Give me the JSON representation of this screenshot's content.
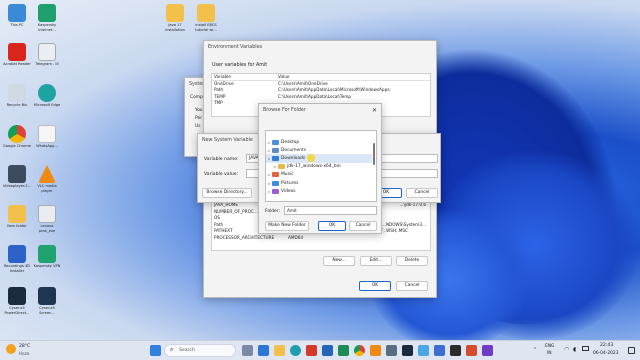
{
  "desktop": {
    "icons": [
      {
        "label": "This PC"
      },
      {
        "label": "Kaspersky Internet..."
      },
      {
        "label": "Acrobat Reader"
      },
      {
        "label": "Telegram - III"
      },
      {
        "label": "Recycle Bin"
      },
      {
        "label": "Microsoft Edge"
      },
      {
        "label": "Google Chrome"
      },
      {
        "label": "WhatsApp..."
      },
      {
        "label": "Videoplayer-2..."
      },
      {
        "label": "VLC media player"
      },
      {
        "label": "New folder"
      },
      {
        "label": "Lenovo pcsk_exe"
      },
      {
        "label": "Recordings 3D Installer"
      },
      {
        "label": "Kaspersky VPN"
      },
      {
        "label": "Cyser.a5 PowerDirect..."
      },
      {
        "label": "Cyser.a5 Screen..."
      },
      {
        "label": "Java 17 installation"
      },
      {
        "label": "install EBCS tutorial wi..."
      }
    ]
  },
  "env_window": {
    "title": "Environment Variables",
    "user_section_label": "User variables for Amit",
    "user_headers": [
      "Variable",
      "Value"
    ],
    "user_rows": [
      [
        "OneDrive",
        "C:\\Users\\Amit\\OneDrive"
      ],
      [
        "Path",
        "C:\\Users\\Amit\\AppData\\Local\\Microsoft\\WindowsApps;"
      ],
      [
        "TEMP",
        "C:\\Users\\Amit\\AppData\\Local\\Temp"
      ],
      [
        "TMP",
        ""
      ]
    ],
    "system_rows": [
      [
        "JAVA_HOME",
        "...\\jdk-17.0.6"
      ],
      [
        "NUMBER_OF_PROC...",
        ""
      ],
      [
        "OS",
        ""
      ],
      [
        "Path",
        "...NDOWS\\System3..."
      ],
      [
        "PATHEXT",
        ".COM;.EXE;.BAT;.CMD;.VBS;.VBE;.JS;.JSE;.WSF;.WSH;.MSC"
      ],
      [
        "PROCESSOR_ARCHITECTURE",
        "AMD64"
      ]
    ],
    "new_label": "New...",
    "edit_label": "Edit...",
    "delete_label": "Delete",
    "ok_label": "OK",
    "cancel_label": "Cancel"
  },
  "sysprops": {
    "title": "System P",
    "tab_label": "Compu",
    "line1": "You",
    "line2": "Per",
    "line3": "Us"
  },
  "new_sys_var": {
    "title": "New System Variable",
    "name_label": "Variable name:",
    "name_value": "JAVA",
    "value_label": "Variable value:",
    "browse_dir_label": "Browse Directory...",
    "ok_label": "OK",
    "cancel_label": "Cancel"
  },
  "browse": {
    "title": "Browse For Folder",
    "items": [
      {
        "label": "Desktop",
        "expand": ">",
        "color": "#4a8fdc"
      },
      {
        "label": "Documents",
        "expand": ">",
        "color": "#5c8fbf"
      },
      {
        "label": "Downloads",
        "expand": "v",
        "color": "#2f7fd6"
      },
      {
        "label": "jdk-17_windows-x64_bin",
        "expand": ">",
        "color": "#e8b84a"
      },
      {
        "label": "Music",
        "expand": ">",
        "color": "#e0683c"
      },
      {
        "label": "Pictures",
        "expand": ">",
        "color": "#3b8ee0"
      },
      {
        "label": "Videos",
        "expand": ">",
        "color": "#9c5cd6"
      }
    ],
    "folder_label": "Folder:",
    "folder_value": "Amit",
    "make_new_label": "Make New Folder",
    "ok_label": "OK",
    "cancel_label": "Cancel"
  },
  "taskbar": {
    "weather_temp": "28°C",
    "weather_desc": "Haze",
    "search_placeholder": "Search",
    "lang_line1": "ENG",
    "lang_line2": "IN",
    "time": "22:43",
    "date": "06-04-2023"
  }
}
